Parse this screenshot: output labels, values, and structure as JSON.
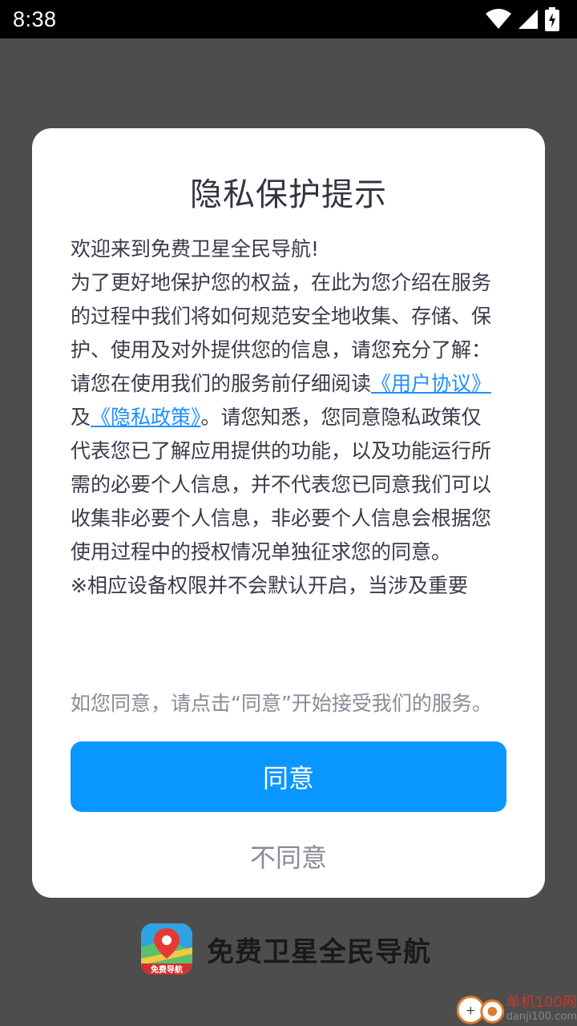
{
  "status_bar": {
    "time": "8:38",
    "icons": [
      "wifi-icon",
      "signal-icon",
      "battery-charging-icon"
    ]
  },
  "dialog": {
    "title": "隐私保护提示",
    "body": {
      "p1": "欢迎来到免费卫星全民导航!",
      "p2": "为了更好地保护您的权益，在此为您介绍在服务的过程中我们将如何规范安全地收集、存储、保护、使用及对外提供您的信息，请您充分了解：",
      "p3_prefix": "请您在使用我们的服务前仔细阅读",
      "user_agreement_link": "《用户协议》",
      "p3_and": "及",
      "privacy_policy_link": "《隐私政策》",
      "p3_suffix": "。请您知悉，您同意隐私政策仅代表您已了解应用提供的功能，以及功能运行所需的必要个人信息，并不代表您已同意我们可以收集非必要个人信息，非必要个人信息会根据您使用过程中的授权情况单独征求您的同意。",
      "p4": "※相应设备权限并不会默认开启，当涉及重要"
    },
    "hint": "如您同意，请点击“同意”开始接受我们的服务。",
    "agree_label": "同意",
    "disagree_label": "不同意"
  },
  "brand": {
    "logo_text": "免费导航",
    "app_name": "免费卫星全民导航"
  },
  "watermark": {
    "title": "单机100网",
    "url": "danji100.com"
  },
  "colors": {
    "accent": "#0a96ff",
    "link": "#1e8fff",
    "overlay": "#4d4d4d"
  }
}
